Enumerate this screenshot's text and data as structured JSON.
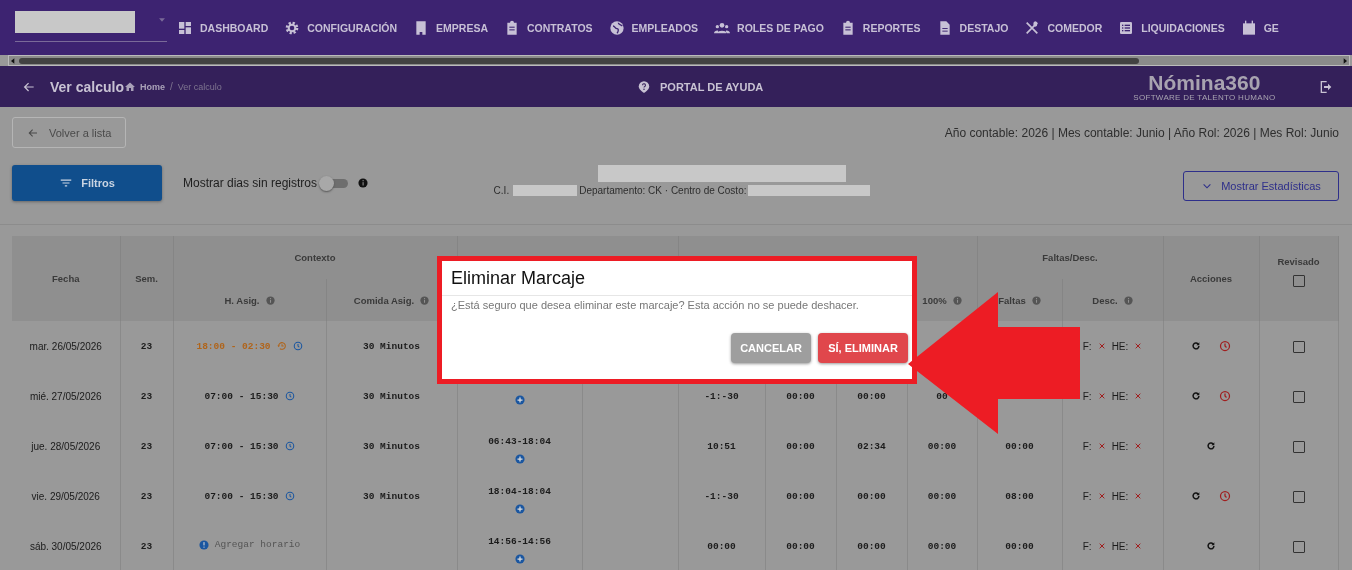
{
  "nav": {
    "items": [
      {
        "label": "DASHBOARD"
      },
      {
        "label": "CONFIGURACIÓN"
      },
      {
        "label": "EMPRESA"
      },
      {
        "label": "CONTRATOS"
      },
      {
        "label": "EMPLEADOS"
      },
      {
        "label": "ROLES DE PAGO"
      },
      {
        "label": "REPORTES"
      },
      {
        "label": "DESTAJO"
      },
      {
        "label": "COMEDOR"
      },
      {
        "label": "LIQUIDACIONES"
      },
      {
        "label": "GE"
      }
    ]
  },
  "subheader": {
    "title": "Ver calculo",
    "breadcrumb": [
      "Home",
      "Ver calculo"
    ],
    "breadcrumb_separator": "/",
    "help": "PORTAL DE AYUDA",
    "logo": "Nómina360",
    "logo_tagline": "SOFTWARE DE TALENTO HUMANO"
  },
  "toolbar": {
    "back_button": "Volver a lista",
    "period": "Año contable: 2026 | Mes contable: Junio | Año Rol: 2026 | Mes Rol: Junio",
    "filters_button": "Filtros",
    "toggle": {
      "label": "Mostrar dias sin registros",
      "on": false
    },
    "employee": {
      "id_label": "C.I.",
      "department": "Departamento: CK · Centro de Costo:"
    },
    "stats_button": "Mostrar Estadísticas"
  },
  "table": {
    "header": {
      "fecha": "Fecha",
      "sem": "Sem.",
      "contexto": "Contexto",
      "h_asig": "H. Asig.",
      "comida_asig": "Comida Asig.",
      "horas_100": "100%",
      "faltas_desc": "Faltas/Desc.",
      "faltas": "Faltas",
      "desc": "Desc.",
      "acciones": "Acciones",
      "revisado": "Revisado",
      "revisado_checked": false
    },
    "rows": [
      {
        "fecha": "mar. 26/05/2026",
        "sem": "23",
        "h_asig": {
          "kind": "overnight",
          "text": "18:00 - 02:30"
        },
        "comida": "30 Minutos",
        "desc": [
          "F:",
          "HE:"
        ],
        "alarm": true,
        "checked": false
      },
      {
        "fecha": "mié. 27/05/2026",
        "sem": "23",
        "h_asig": {
          "kind": "schedule",
          "text": "07:00 - 15:30"
        },
        "comida": "30 Minutos",
        "horas": [
          "-1:-30",
          "00:00",
          "00:00",
          "00"
        ],
        "desc": [
          "F:",
          "HE:"
        ],
        "alarm": true,
        "checked": false
      },
      {
        "fecha": "jue. 28/05/2026",
        "sem": "23",
        "h_asig": {
          "kind": "schedule",
          "text": "07:00 - 15:30"
        },
        "comida": "30 Minutos",
        "marcaje": "06:43-18:04",
        "horas": [
          "10:51",
          "00:00",
          "02:34",
          "00:00"
        ],
        "faltas": "00:00",
        "desc": [
          "F:",
          "HE:"
        ],
        "alarm": false,
        "checked": false
      },
      {
        "fecha": "vie. 29/05/2026",
        "sem": "23",
        "h_asig": {
          "kind": "schedule",
          "text": "07:00 - 15:30"
        },
        "comida": "30 Minutos",
        "marcaje": "18:04-18:04",
        "horas": [
          "-1:-30",
          "00:00",
          "00:00",
          "00:00"
        ],
        "faltas": "08:00",
        "desc": [
          "F:",
          "HE:"
        ],
        "alarm": true,
        "checked": false
      },
      {
        "fecha": "sáb. 30/05/2026",
        "sem": "23",
        "h_asig": {
          "kind": "add",
          "text": "Agregar horario"
        },
        "marcaje": "14:56-14:56",
        "horas": [
          "00:00",
          "00:00",
          "00:00",
          "00:00"
        ],
        "faltas": "00:00",
        "desc": [
          "F:",
          "HE:"
        ],
        "alarm": false,
        "checked": false
      }
    ]
  },
  "dialog": {
    "title": "Eliminar Marcaje",
    "message": "¿Está seguro que desea eliminar este marcaje? Esta acción no se puede deshacer.",
    "buttons": [
      {
        "label": "CANCELAR",
        "kind": "cancel"
      },
      {
        "label": "SÍ, ELIMINAR",
        "kind": "danger"
      }
    ]
  }
}
